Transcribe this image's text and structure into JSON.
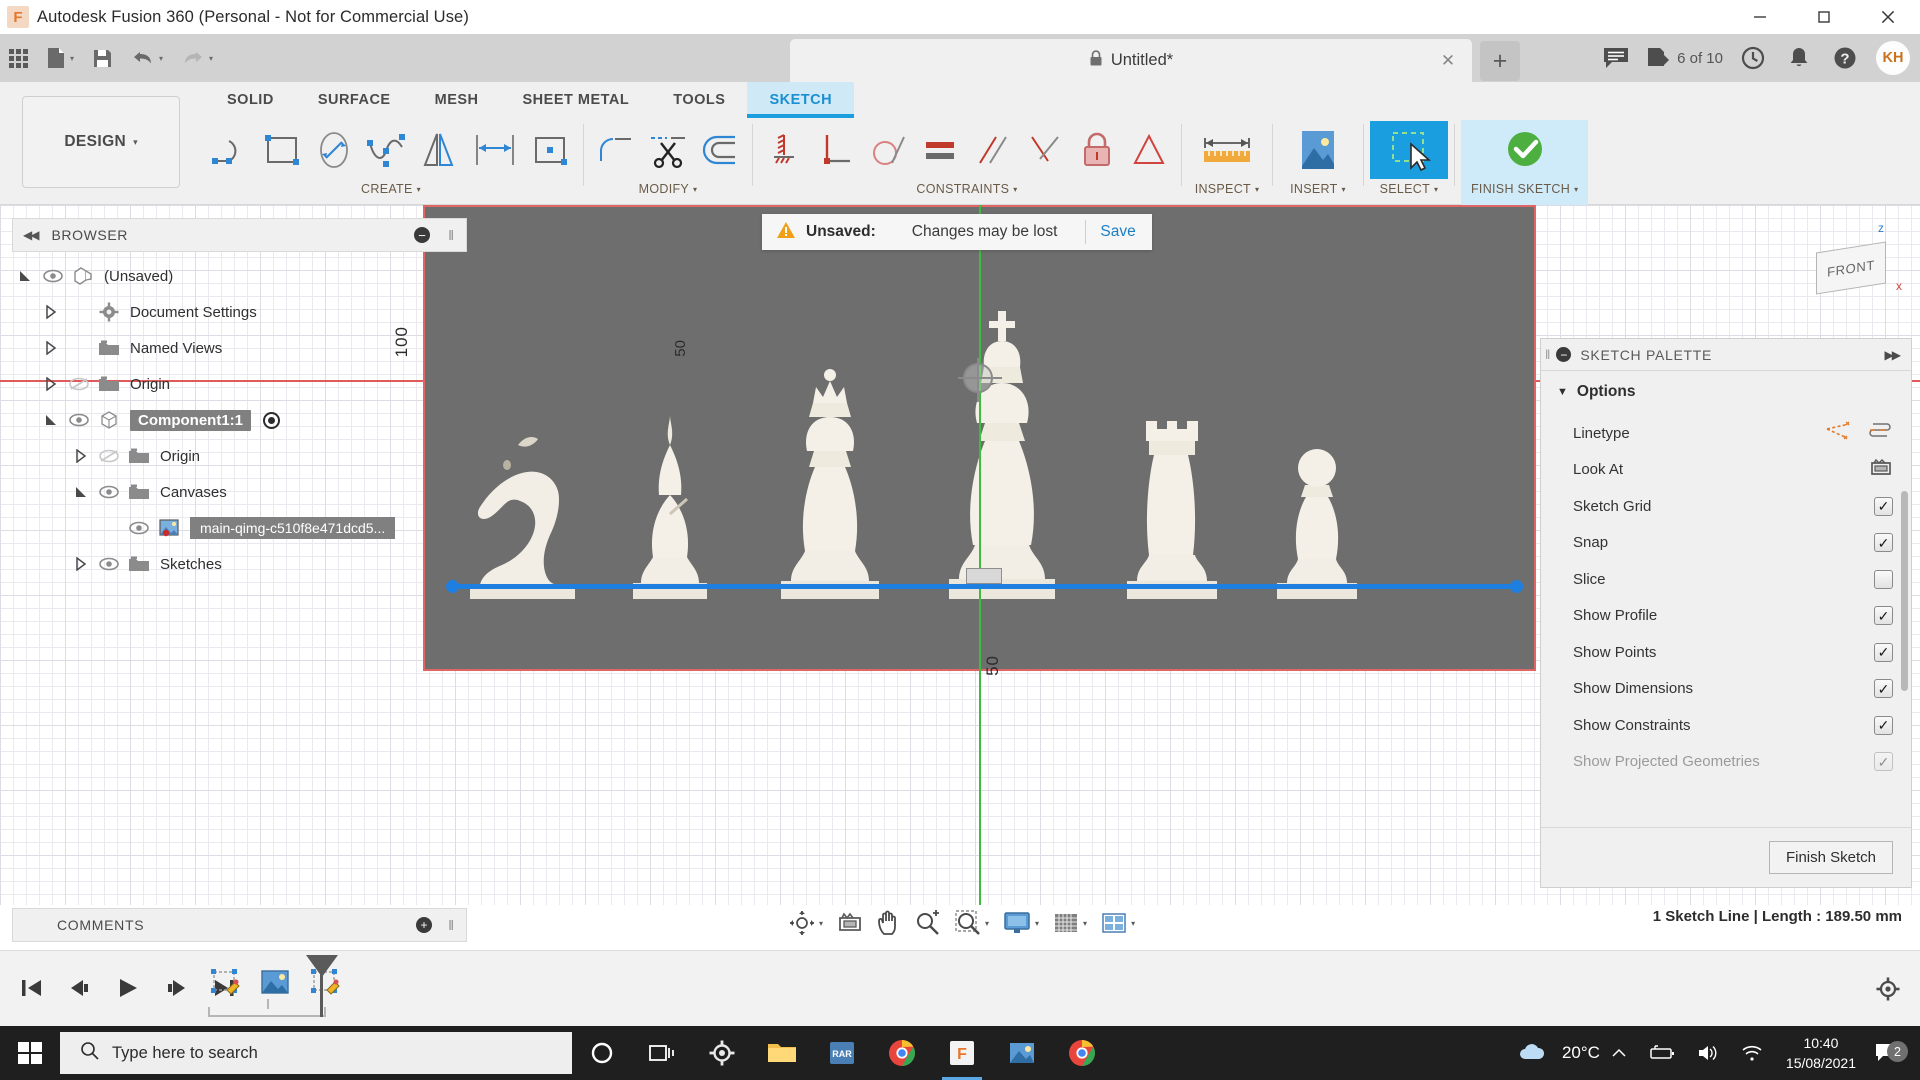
{
  "window": {
    "title": "Autodesk Fusion 360 (Personal - Not for Commercial Use)",
    "logo_letter": "F",
    "minimize": "minimize-icon",
    "maximize": "maximize-icon",
    "close": "close-icon"
  },
  "quick_access": {
    "apps_grid": "apps-grid-icon",
    "new_file": "new-file-icon",
    "save": "save-icon",
    "undo": "undo-icon",
    "redo": "redo-icon",
    "caret": "▾"
  },
  "document_tab": {
    "lock_icon": "🔒",
    "name": "Untitled*",
    "close": "✕",
    "add_tab": "+"
  },
  "account_bar": {
    "comment_icon": "comment-icon",
    "jobs_icon": "jobs-icon",
    "jobs_count": "6 of 10",
    "recent_icon": "recent-icon",
    "notifications_icon": "bell-icon",
    "help_icon": "help-icon",
    "avatar_initials": "KH"
  },
  "workspace": {
    "label": "DESIGN",
    "caret": "▾"
  },
  "ribbon": {
    "tabs": [
      {
        "label": "SOLID",
        "active": false
      },
      {
        "label": "SURFACE",
        "active": false
      },
      {
        "label": "MESH",
        "active": false
      },
      {
        "label": "SHEET METAL",
        "active": false
      },
      {
        "label": "TOOLS",
        "active": false
      },
      {
        "label": "SKETCH",
        "active": true
      }
    ],
    "panels": [
      {
        "label": "CREATE",
        "caret": "▾",
        "icons": [
          "line-icon",
          "rectangle-icon",
          "ellipse-icon",
          "spline-icon",
          "mirror-icon",
          "dimension-icon",
          "center-rectangle-icon"
        ]
      },
      {
        "label": "MODIFY",
        "caret": "▾",
        "icons": [
          "fillet-icon",
          "trim-icon",
          "offset-icon"
        ]
      },
      {
        "label": "CONSTRAINTS",
        "caret": "▾",
        "icons": [
          "horizontal-vertical-constraint-icon",
          "perpendicular-constraint-icon",
          "tangent-constraint-icon",
          "equal-constraint-icon",
          "parallel-constraint-icon",
          "coincident-constraint-icon",
          "fix-constraint-icon",
          "symmetry-constraint-icon"
        ]
      },
      {
        "label": "INSPECT",
        "caret": "▾",
        "icons": [
          "measure-icon"
        ]
      },
      {
        "label": "INSERT",
        "caret": "▾",
        "icons": [
          "insert-canvas-icon"
        ]
      },
      {
        "label": "SELECT",
        "caret": "▾",
        "icons": [
          "select-window-icon"
        ]
      },
      {
        "label": "FINISH SKETCH",
        "caret": "▾",
        "icons": [
          "finish-sketch-check-icon"
        ]
      }
    ]
  },
  "browser": {
    "header_title": "BROWSER",
    "collapse_icon": "◀◀",
    "minus_icon": "−",
    "grip_icon": "‖",
    "tree": [
      {
        "label": "(Unsaved)",
        "indent": 0,
        "twisty": "expanded",
        "eye": "visible",
        "icon": "document-icon",
        "selected": false
      },
      {
        "label": "Document Settings",
        "indent": 1,
        "twisty": "collapsed",
        "eye": "none",
        "icon": "gear-icon",
        "selected": false
      },
      {
        "label": "Named Views",
        "indent": 1,
        "twisty": "collapsed",
        "eye": "none",
        "icon": "folder-icon",
        "selected": false
      },
      {
        "label": "Origin",
        "indent": 1,
        "twisty": "collapsed",
        "eye": "hidden",
        "icon": "folder-icon",
        "selected": false
      },
      {
        "label": "Component1:1",
        "indent": 1,
        "twisty": "expanded",
        "eye": "visible",
        "icon": "component-icon",
        "selected": true,
        "radio": true
      },
      {
        "label": "Origin",
        "indent": 2,
        "twisty": "collapsed",
        "eye": "hidden",
        "icon": "folder-icon",
        "selected": false
      },
      {
        "label": "Canvases",
        "indent": 2,
        "twisty": "expanded",
        "eye": "visible",
        "icon": "folder-icon",
        "selected": false
      },
      {
        "label": "main-qimg-c510f8e471dcd5...",
        "indent": 3,
        "twisty": "none",
        "eye": "visible",
        "icon": "canvas-image-icon",
        "selected": false,
        "highlight": true
      },
      {
        "label": "Sketches",
        "indent": 2,
        "twisty": "collapsed",
        "eye": "visible",
        "icon": "folder-icon",
        "selected": false
      }
    ]
  },
  "toast": {
    "warn_icon": "⚠",
    "label": "Unsaved:",
    "message": "Changes may be lost",
    "action": "Save"
  },
  "viewcube": {
    "face_label": "FRONT",
    "axis_z": "z",
    "axis_x": "x"
  },
  "viewport": {
    "dimension_left": "100",
    "dimension_mid": "50",
    "dimension_bottom": "50"
  },
  "palette": {
    "header_title": "SKETCH PALETTE",
    "minus_icon": "−",
    "expand_icon": "▶▶",
    "grip_icon": "‖",
    "section_title": "Options",
    "section_tri": "▼",
    "rows": [
      {
        "label": "Linetype",
        "control": "icons",
        "icons": [
          "construction-line-icon",
          "centerline-icon"
        ]
      },
      {
        "label": "Look At",
        "control": "icon",
        "icons": [
          "look-at-icon"
        ]
      },
      {
        "label": "Sketch Grid",
        "control": "checkbox",
        "checked": true
      },
      {
        "label": "Snap",
        "control": "checkbox",
        "checked": true
      },
      {
        "label": "Slice",
        "control": "checkbox",
        "checked": false
      },
      {
        "label": "Show Profile",
        "control": "checkbox",
        "checked": true
      },
      {
        "label": "Show Points",
        "control": "checkbox",
        "checked": true
      },
      {
        "label": "Show Dimensions",
        "control": "checkbox",
        "checked": true
      },
      {
        "label": "Show Constraints",
        "control": "checkbox",
        "checked": true
      },
      {
        "label": "Show Projected Geometries",
        "control": "checkbox",
        "checked": true
      }
    ],
    "finish_button": "Finish Sketch"
  },
  "comments": {
    "title": "COMMENTS",
    "plus_icon": "+",
    "grip_icon": "‖"
  },
  "nav_bar": {
    "icons": [
      "orbit-icon",
      "look-at-icon",
      "pan-icon",
      "zoom-icon",
      "zoom-window-icon",
      "display-settings-icon",
      "grid-snap-icon",
      "viewport-layout-icon"
    ],
    "caret": "▾"
  },
  "status": {
    "text": "1 Sketch Line | Length : 189.50 mm"
  },
  "timeline": {
    "controls": [
      "go-to-beginning-icon",
      "step-back-icon",
      "play-icon",
      "step-forward-icon",
      "go-to-end-icon"
    ],
    "features": [
      "sketch-feature-icon",
      "canvas-feature-icon",
      "sketch-feature-icon"
    ],
    "settings_icon": "gear-icon"
  },
  "taskbar": {
    "start_icon": "windows-start-icon",
    "search_placeholder": "Type here to search",
    "search_icon": "search-icon",
    "items": [
      {
        "name": "cortana-icon",
        "active": false
      },
      {
        "name": "task-view-icon",
        "active": false
      },
      {
        "name": "settings-icon",
        "active": false
      },
      {
        "name": "file-explorer-icon",
        "active": false
      },
      {
        "name": "winrar-icon",
        "active": false
      },
      {
        "name": "chrome-icon",
        "active": false
      },
      {
        "name": "fusion360-icon",
        "active": true
      },
      {
        "name": "photos-icon",
        "active": false
      },
      {
        "name": "chrome-2-icon",
        "active": false
      }
    ],
    "tray": {
      "weather_icon": "cloud-icon",
      "temperature": "20°C",
      "chevron_up": "∧",
      "battery_icon": "battery-icon",
      "volume_icon": "volume-icon",
      "wifi_icon": "wifi-icon",
      "time": "10:40",
      "date": "15/08/2021",
      "action_center_icon": "action-center-icon",
      "notification_count": "2"
    }
  },
  "colors": {
    "accent_blue": "#1a9ee0",
    "sketch_line": "#1f7fe0",
    "axis_red": "#e05a5a",
    "axis_green": "#3dbd3d",
    "warn_orange": "#f0a018",
    "canvas_bg": "#6e6e6e"
  }
}
